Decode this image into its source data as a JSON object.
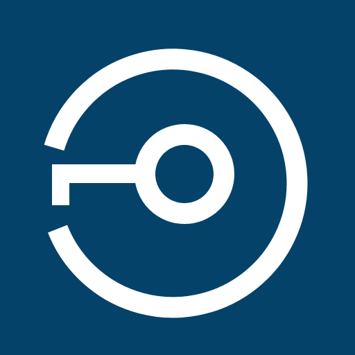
{
  "app_icon": {
    "icon": "key-circle-logo-icon",
    "colors": {
      "background": "#05426a",
      "mark": "#ffffff"
    }
  }
}
